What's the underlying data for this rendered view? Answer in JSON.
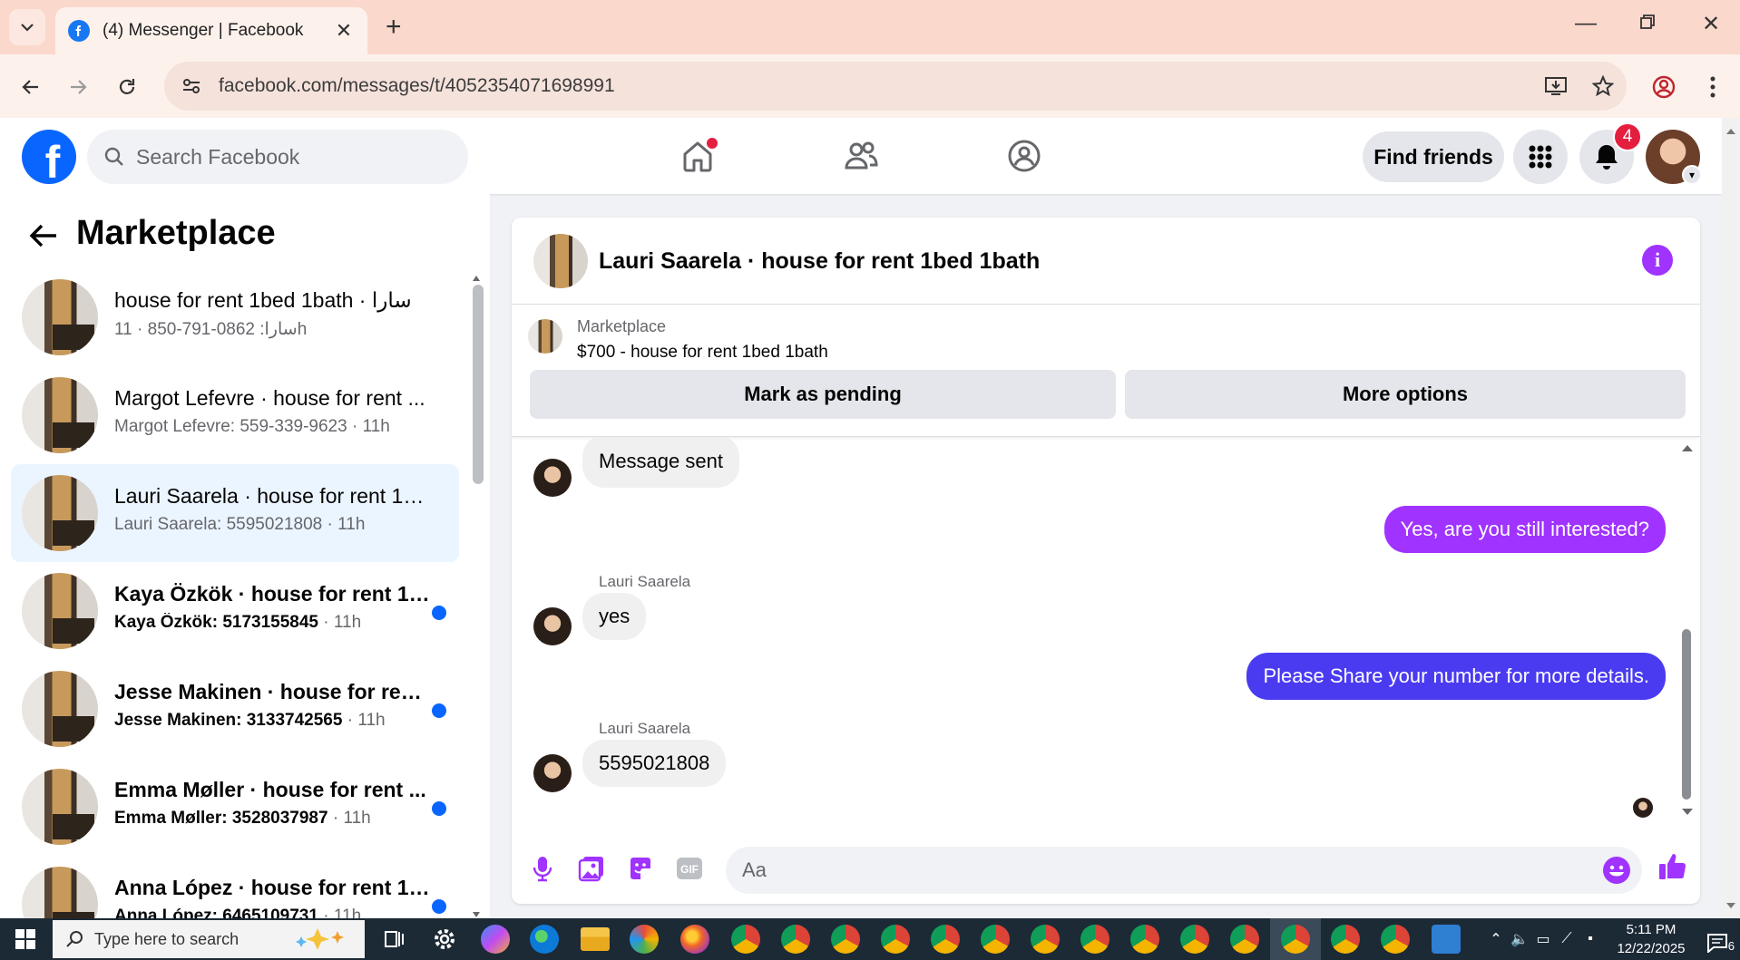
{
  "browser": {
    "tab_title": "(4) Messenger | Facebook",
    "url": "facebook.com/messages/t/4052354071698991"
  },
  "fb_header": {
    "logo_letter": "f",
    "search_placeholder": "Search Facebook",
    "find_friends_label": "Find friends",
    "notification_count": "4"
  },
  "sidebar": {
    "title": "Marketplace",
    "conversations": [
      {
        "name": "سارا · house for rent 1bed 1bath",
        "preview": "سارا: 0862-791-850",
        "time": "11h",
        "unread": false,
        "active": false
      },
      {
        "name": "Margot Lefevre · house for rent ...",
        "preview": "Margot Lefevre: 559-339-9623",
        "time": "11h",
        "unread": false,
        "active": false
      },
      {
        "name": "Lauri Saarela · house for rent 1b...",
        "preview": "Lauri Saarela: 5595021808",
        "time": "11h",
        "unread": false,
        "active": true
      },
      {
        "name": "Kaya Özkök · house for rent 1b...",
        "preview": "Kaya Özkök: 5173155845",
        "time": "11h",
        "unread": true,
        "active": false
      },
      {
        "name": "Jesse Makinen · house for rent...",
        "preview": "Jesse Makinen: 3133742565",
        "time": "11h",
        "unread": true,
        "active": false
      },
      {
        "name": "Emma Møller · house for rent ...",
        "preview": "Emma Møller: 3528037987",
        "time": "11h",
        "unread": true,
        "active": false
      },
      {
        "name": "Anna López · house for rent 1b...",
        "preview": "Anna López: 6465109731",
        "time": "11h",
        "unread": true,
        "active": false
      }
    ]
  },
  "chat": {
    "title": "Lauri Saarela · house for rent 1bed 1bath",
    "listing_label": "Marketplace",
    "listing_title": "$700 - house for rent 1bed 1bath",
    "mark_pending_label": "Mark as pending",
    "more_options_label": "More options",
    "messages": [
      {
        "dir": "in",
        "sender": "",
        "text": "Message sent"
      },
      {
        "dir": "out",
        "text": "Yes, are you still interested?"
      },
      {
        "dir": "in",
        "sender": "Lauri Saarela",
        "text": "yes"
      },
      {
        "dir": "out",
        "text": "Please Share your number for more details."
      },
      {
        "dir": "in",
        "sender": "Lauri Saarela",
        "text": "5595021808"
      }
    ],
    "composer_placeholder": "Aa"
  },
  "taskbar": {
    "search_placeholder": "Type here to search",
    "time": "5:11 PM",
    "date": "12/22/2025",
    "notification_count": "6"
  },
  "colors": {
    "fb_blue": "#0866ff",
    "active_conv": "#ebf5ff",
    "out_bubble_purple": "#a033ff",
    "out_bubble_blue": "#4a3bf0",
    "unread_dot": "#0866ff",
    "badge_red": "#e41e3f",
    "browser_tabbar": "#fbd8cc"
  }
}
